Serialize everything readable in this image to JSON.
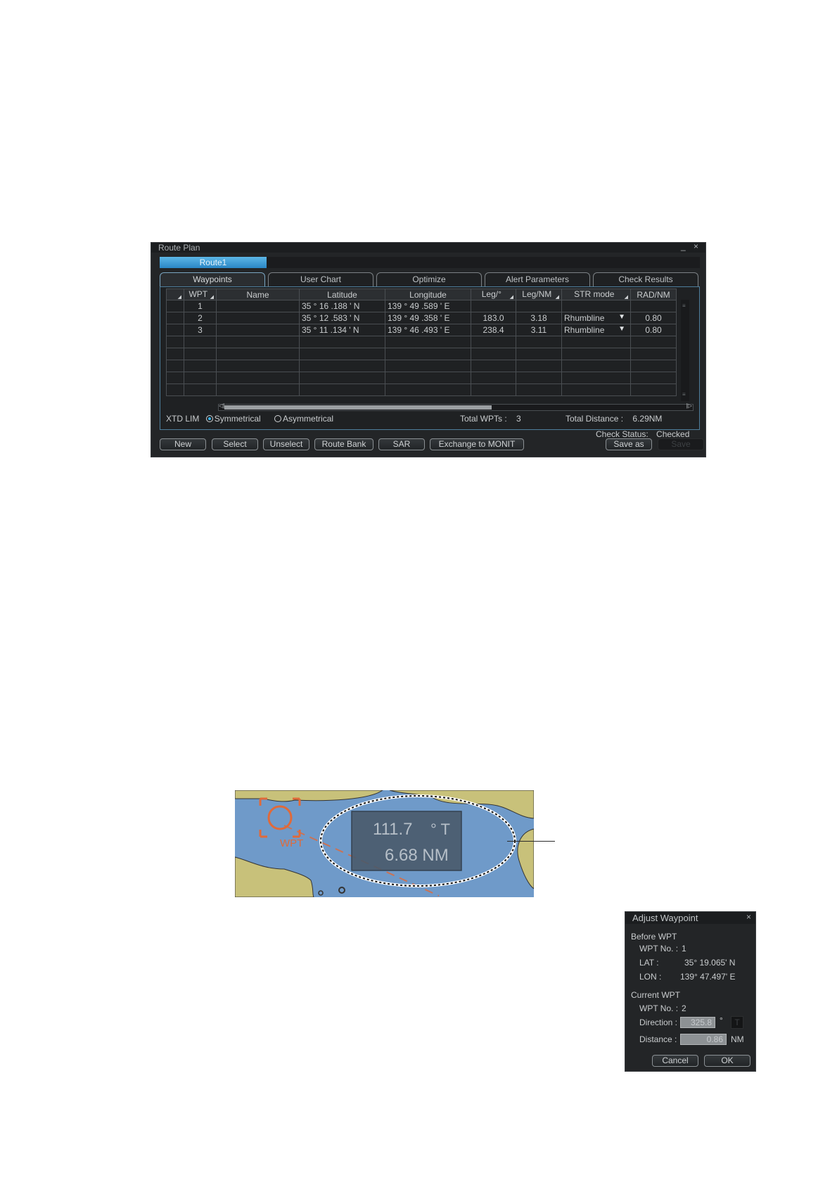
{
  "route_plan": {
    "title": "Route Plan",
    "window_controls": "_ ×",
    "route_tab": "Route1",
    "tabs": [
      "Waypoints",
      "User Chart",
      "Optimize",
      "Alert Parameters",
      "Check Results"
    ],
    "columns": [
      "",
      "WPT",
      "Name",
      "Latitude",
      "Longitude",
      "Leg/°",
      "Leg/NM",
      "STR mode",
      "RAD/NM"
    ],
    "rows": [
      {
        "wpt": "1",
        "name": "",
        "lat": "35 ° 16 .188 ' N",
        "lon": "139 ° 49 .589 ' E",
        "leg_deg": "",
        "leg_nm": "",
        "str_mode": "",
        "rad": ""
      },
      {
        "wpt": "2",
        "name": "",
        "lat": "35 ° 12 .583 ' N",
        "lon": "139 ° 49 .358 ' E",
        "leg_deg": "183.0",
        "leg_nm": "3.18",
        "str_mode": "Rhumbline",
        "rad": "0.80"
      },
      {
        "wpt": "3",
        "name": "",
        "lat": "35 ° 11 .134 ' N",
        "lon": "139 ° 46 .493 ' E",
        "leg_deg": "238.4",
        "leg_nm": "3.11",
        "str_mode": "Rhumbline",
        "rad": "0.80"
      }
    ],
    "empty_rows": 5,
    "xtd_lim_label": "XTD LIM",
    "xtd_options": [
      "Symmetrical",
      "Asymmetrical"
    ],
    "xtd_selected": "Symmetrical",
    "total_wpts_label": "Total WPTs :",
    "total_wpts": "3",
    "total_distance_label": "Total Distance :",
    "total_distance": "6.29NM",
    "check_status_label": "Check Status:",
    "check_status": "Checked",
    "buttons": [
      "New",
      "Select",
      "Unselect",
      "Route Bank",
      "SAR",
      "Exchange to MONIT",
      "Save as",
      "Save"
    ]
  },
  "map": {
    "wpt_label": "WPT",
    "bearing": "111.7",
    "bearing_unit": "° T",
    "distance": "6.68 NM",
    "colors": {
      "sea": "#6f9ac9",
      "land": "#c8c17a",
      "wpt": "#e06a3a"
    }
  },
  "adjust_waypoint": {
    "title": "Adjust Waypoint",
    "close": "×",
    "before_wpt": "Before WPT",
    "before_no_label": "WPT No. :",
    "before_no": "1",
    "lat_label": "LAT :",
    "lat": "35° 19.065' N",
    "lon_label": "LON :",
    "lon": "139° 47.497' E",
    "current_wpt": "Current WPT",
    "current_no_label": "WPT No. :",
    "current_no": "2",
    "direction_label": "Direction :",
    "direction": "325.8",
    "direction_unit": "°",
    "direction_ref": "T",
    "distance_label": "Distance :",
    "distance": "0.86",
    "distance_unit": "NM",
    "cancel": "Cancel",
    "ok": "OK"
  }
}
